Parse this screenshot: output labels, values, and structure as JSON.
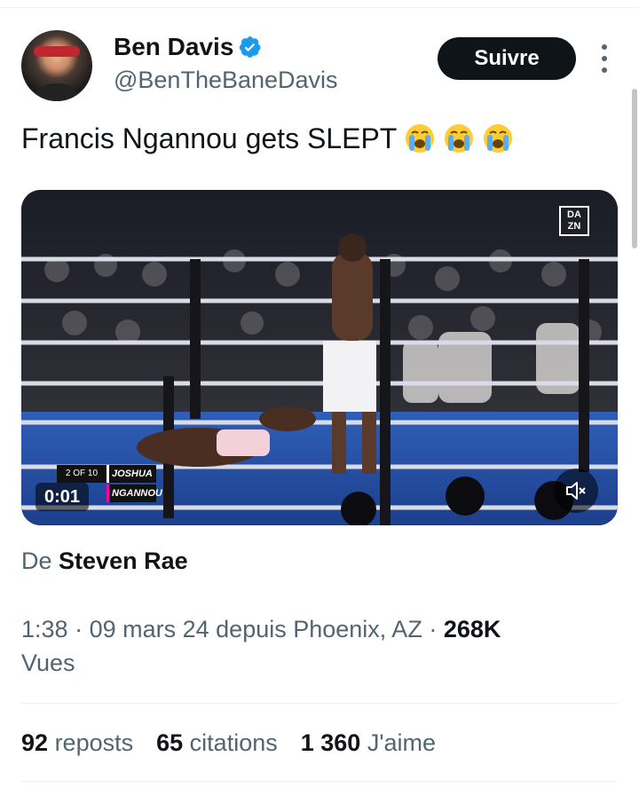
{
  "author": {
    "display_name": "Ben Davis",
    "handle": "@BenTheBaneDavis",
    "verified_icon": "verified-badge-icon",
    "avatar": "profile-photo"
  },
  "follow_label": "Suivre",
  "tweet": {
    "text": "Francis Ngannou gets SLEPT",
    "emojis": [
      "loudly-crying-face",
      "loudly-crying-face",
      "loudly-crying-face"
    ]
  },
  "media": {
    "type": "video",
    "time": "0:01",
    "broadcaster": "DA ZN",
    "scorebug": {
      "round": "2 OF 10",
      "fighter_top": "JOSHUA",
      "fighter_bottom": "NGANNOU"
    },
    "mute_icon": "speaker-muted-icon"
  },
  "source": {
    "prefix": "De",
    "name": "Steven Rae"
  },
  "meta": {
    "time": "1:38",
    "date": "09 mars 24 depuis Phoenix, AZ",
    "views_count": "268K",
    "views_label": "Vues"
  },
  "stats": {
    "reposts_count": "92",
    "reposts_label": "reposts",
    "quotes_count": "65",
    "quotes_label": "citations",
    "likes_count": "1 360",
    "likes_label": "J'aime"
  },
  "colors": {
    "accent": "#1d9bf0",
    "text": "#0f1419",
    "secondary": "#536471",
    "button": "#0f1419"
  }
}
